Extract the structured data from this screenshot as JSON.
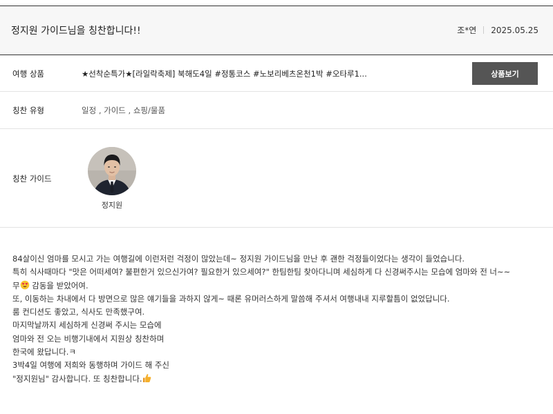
{
  "review": {
    "title": "정지원 가이드님을 칭찬합니다!!",
    "author": "조*연",
    "date": "2025.05.25"
  },
  "product": {
    "label": "여행 상품",
    "name": "★선착순특가★[라일락축제] 북해도4일 #정통코스 #노보리베츠온천1박 #오타루1...",
    "button_label": "상품보기"
  },
  "praise_type": {
    "label": "칭찬 유형",
    "value": "일정 , 가이드 , 쇼핑/물품"
  },
  "guide": {
    "label": "칭찬 가이드",
    "name": "정지원",
    "avatar_icon": "guide-portrait"
  },
  "content": {
    "lines": [
      "84살이신 엄마를 모시고 가는 여행길에 이런저런 걱정이 많았는데~ 정지원 가이드님을 만난 후 괜한 걱정들이었다는 생각이 들었습니다.",
      "특히 식사때마다 \"맛은 어떠세여? 불편한거 있으신가여? 필요한거 있으세여?\" 한팀한팀 찾아다니며 세심하게 다 신경써주시는 모습에 엄마와 전 너~~",
      "무",
      " 감동을 받았어여.",
      "또, 이동하는 차내에서 다 방면으로 많은 얘기들을 과하지 않게~ 때론 유머러스하게 말씀해 주셔서 여행내내 지루할틈이 없었답니다.",
      "룸 컨디션도 좋았고, 식사도 만족했구여.",
      "마지막날까지 세심하게 신경써 주시는 모습에",
      "엄마와 전 오는 비행기내에서 지원상 칭찬하며",
      "한국에 왔답니다.ㅋ",
      "3박4일 여행에 저희와 동행하며 가이드 해 주신",
      "\"정지원님\" 감사합니다. 또 칭찬합니다."
    ],
    "emoji_heart_eyes": "heart-eyes-emoji",
    "emoji_thumbs_up": "thumbs-up-emoji"
  }
}
